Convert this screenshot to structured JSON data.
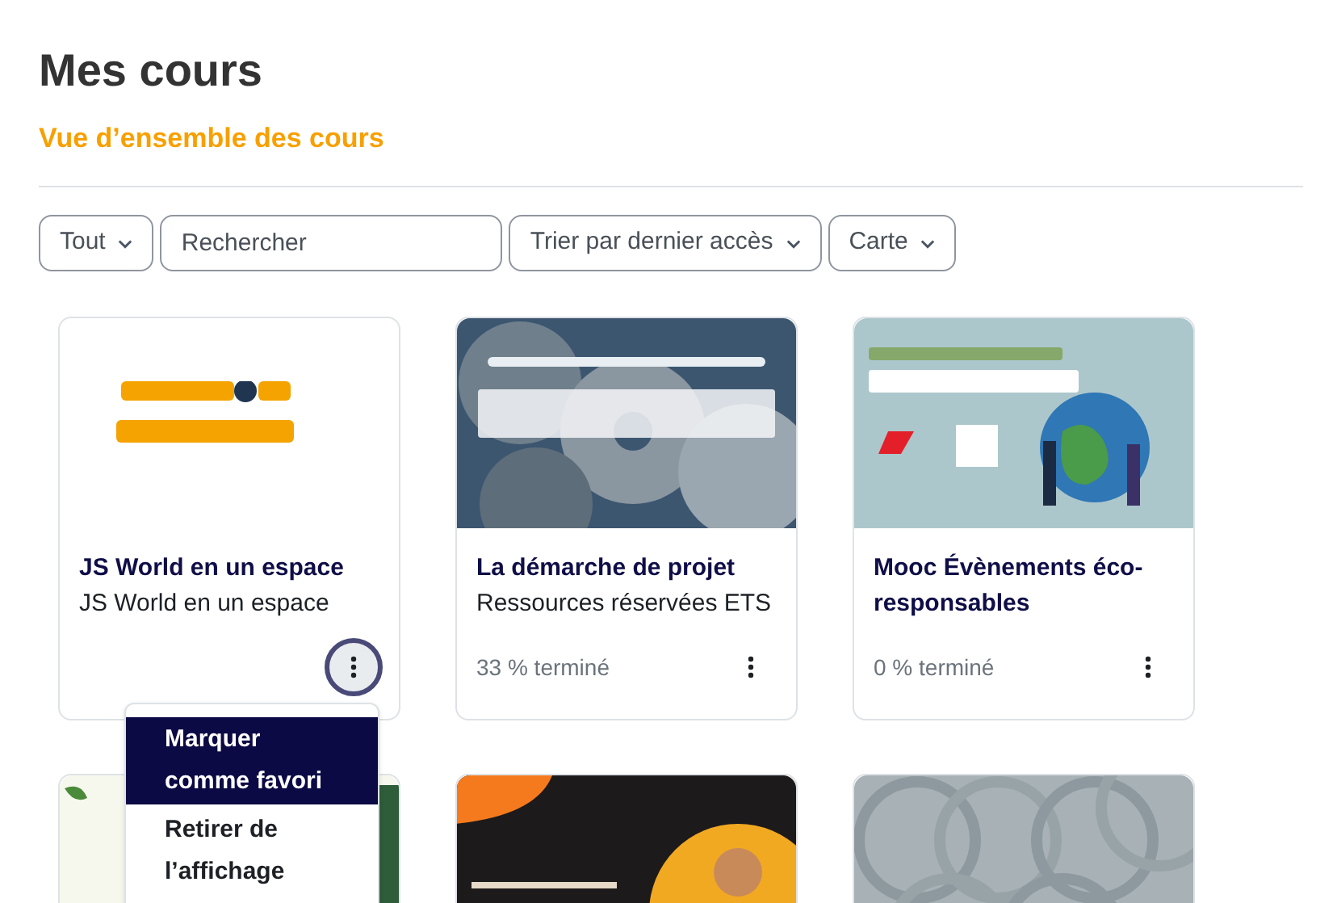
{
  "title": "Mes cours",
  "subtitle": "Vue d’ensemble des cours",
  "filters": [
    {
      "kind": "dropdown",
      "label": "Tout"
    },
    {
      "kind": "search",
      "placeholder": "Rechercher"
    },
    {
      "kind": "dropdown",
      "label": "Trier par dernier accès"
    },
    {
      "kind": "dropdown",
      "label": "Carte"
    }
  ],
  "courses": [
    {
      "kind": "course",
      "title": "JS World en un espace",
      "subtitle": "JS World en un espace",
      "menu_focused": true
    },
    {
      "kind": "course",
      "title": "La démarche de projet",
      "subtitle": "Ressources réservées ETS",
      "progress": "33 % terminé",
      "menu_focused": false
    },
    {
      "kind": "course",
      "title": "Mooc Évènements éco-responsables",
      "progress": "0 % terminé",
      "menu_focused": false
    },
    {
      "kind": "picture"
    },
    {
      "kind": "picture"
    },
    {
      "kind": "picture"
    }
  ],
  "menu": [
    {
      "label": "Marquer comme favori",
      "selected": true
    },
    {
      "label": "Retirer de l’affichage",
      "selected": false
    }
  ]
}
